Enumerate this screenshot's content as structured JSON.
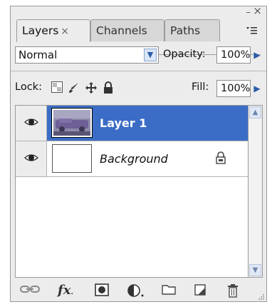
{
  "window": {
    "minimize_glyph": "–",
    "close_glyph": "×"
  },
  "tabs": [
    {
      "label": "Layers",
      "close": "×",
      "active": true
    },
    {
      "label": "Channels",
      "active": false
    },
    {
      "label": "Paths",
      "active": false
    }
  ],
  "blend": {
    "mode": "Normal",
    "opacity_label": "Opacity:",
    "opacity_value": "100%"
  },
  "lock": {
    "label": "Lock:",
    "fill_label": "Fill:",
    "fill_value": "100%"
  },
  "layers": [
    {
      "name": "Layer 1",
      "visible": true,
      "selected": true,
      "locked": false
    },
    {
      "name": "Background",
      "visible": true,
      "selected": false,
      "locked": true
    }
  ],
  "colors": {
    "selection": "#3b6dc6",
    "accent": "#2c5ba8"
  },
  "bottom_icons": [
    "link-layers-icon",
    "fx-icon",
    "mask-icon",
    "adjustment-icon",
    "group-folder-icon",
    "new-layer-icon",
    "trash-icon"
  ],
  "fx_text": "fx"
}
